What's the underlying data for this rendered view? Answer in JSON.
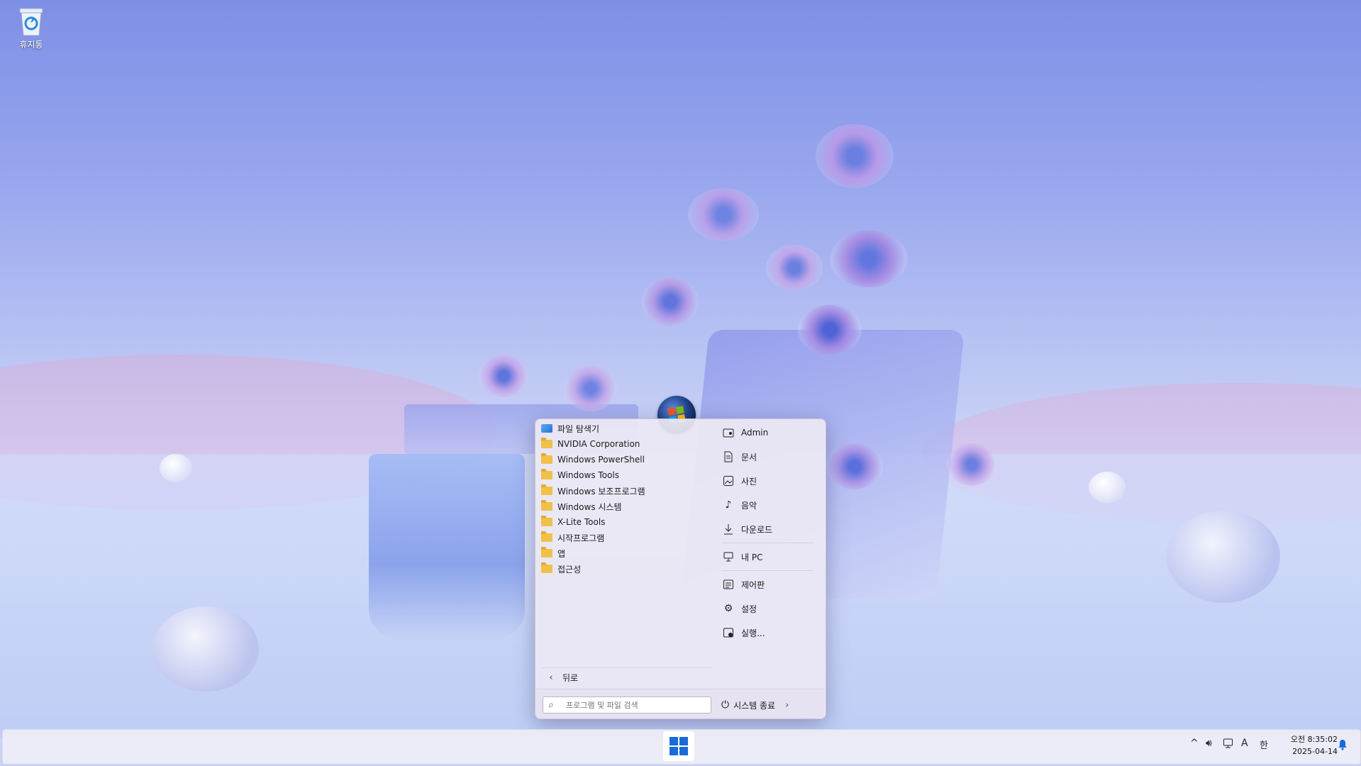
{
  "desktop": {
    "icons": [
      {
        "label": "휴지통",
        "icon": "recycle-bin-icon"
      }
    ]
  },
  "start_menu": {
    "programs": [
      {
        "label": "파일 탐색기",
        "icon": "file-explorer-icon"
      },
      {
        "label": "NVIDIA Corporation",
        "icon": "folder-icon"
      },
      {
        "label": "Windows PowerShell",
        "icon": "folder-icon"
      },
      {
        "label": "Windows Tools",
        "icon": "folder-icon"
      },
      {
        "label": "Windows 보조프로그램",
        "icon": "folder-icon"
      },
      {
        "label": "Windows 시스템",
        "icon": "folder-icon"
      },
      {
        "label": "X-Lite Tools",
        "icon": "folder-icon"
      },
      {
        "label": "시작프로그램",
        "icon": "folder-icon"
      },
      {
        "label": "앱",
        "icon": "folder-icon"
      },
      {
        "label": "접근성",
        "icon": "folder-icon"
      }
    ],
    "back_label": "뒤로",
    "right_items": [
      {
        "label": "Admin",
        "icon": "user-folder-icon"
      },
      {
        "label": "문서",
        "icon": "document-icon"
      },
      {
        "label": "사진",
        "icon": "picture-icon"
      },
      {
        "label": "음악",
        "icon": "music-icon"
      },
      {
        "label": "다운로드",
        "icon": "download-icon"
      },
      {
        "label": "내 PC",
        "icon": "computer-icon"
      },
      {
        "label": "제어판",
        "icon": "control-panel-icon"
      },
      {
        "label": "설정",
        "icon": "gear-icon"
      },
      {
        "label": "실행...",
        "icon": "run-icon"
      }
    ],
    "search_placeholder": "프로그램 및 파일 검색",
    "shutdown_label": "시스템 종료"
  },
  "taskbar": {
    "tray_icons": [
      "chevron-up-icon",
      "volume-icon",
      "network-icon",
      "font-icon",
      "ime-icon"
    ],
    "ime_label": "한",
    "font_label": "A",
    "clock_time": "오전 8:35:02",
    "clock_date": "2025-04-14"
  },
  "colors": {
    "accent": "#1a6ad8",
    "folder": "#f0c14a"
  }
}
